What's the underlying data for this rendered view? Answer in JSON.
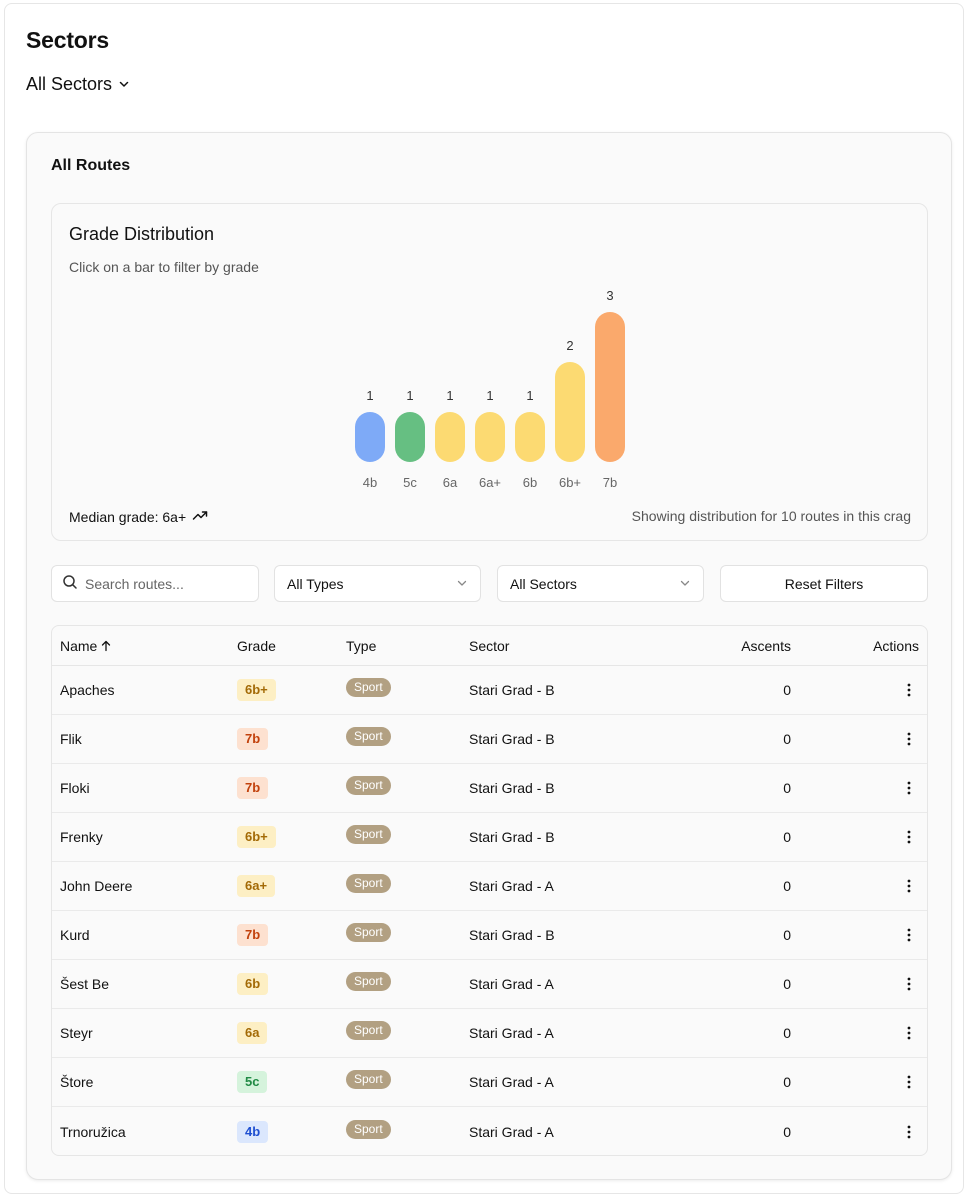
{
  "page": {
    "title": "Sectors",
    "sector_select": "All Sectors"
  },
  "card": {
    "title": "All Routes"
  },
  "distribution": {
    "title": "Grade Distribution",
    "subtitle": "Click on a bar to filter by grade",
    "median_label": "Median grade: 6a+",
    "showing_text": "Showing distribution for 10 routes in this crag"
  },
  "chart_data": {
    "type": "bar",
    "categories": [
      "4b",
      "5c",
      "6a",
      "6a+",
      "6b",
      "6b+",
      "7b"
    ],
    "values": [
      1,
      1,
      1,
      1,
      1,
      2,
      3
    ],
    "colors": [
      "#7eaaf7",
      "#66bf82",
      "#fcda72",
      "#fcda72",
      "#fcda72",
      "#fcda72",
      "#faa96c"
    ],
    "title": "Grade Distribution",
    "xlabel": "",
    "ylabel": "",
    "ylim": [
      0,
      3
    ]
  },
  "filters": {
    "search_placeholder": "Search routes...",
    "type_select": "All Types",
    "sector_select": "All Sectors",
    "reset_label": "Reset Filters"
  },
  "table": {
    "headers": {
      "name": "Name",
      "grade": "Grade",
      "type": "Type",
      "sector": "Sector",
      "ascents": "Ascents",
      "actions": "Actions"
    },
    "rows": [
      {
        "name": "Apaches",
        "grade": "6b+",
        "type": "Sport",
        "sector": "Stari Grad - B",
        "ascents": "0"
      },
      {
        "name": "Flik",
        "grade": "7b",
        "type": "Sport",
        "sector": "Stari Grad - B",
        "ascents": "0"
      },
      {
        "name": "Floki",
        "grade": "7b",
        "type": "Sport",
        "sector": "Stari Grad - B",
        "ascents": "0"
      },
      {
        "name": "Frenky",
        "grade": "6b+",
        "type": "Sport",
        "sector": "Stari Grad - B",
        "ascents": "0"
      },
      {
        "name": "John Deere",
        "grade": "6a+",
        "type": "Sport",
        "sector": "Stari Grad - A",
        "ascents": "0"
      },
      {
        "name": "Kurd",
        "grade": "7b",
        "type": "Sport",
        "sector": "Stari Grad - B",
        "ascents": "0"
      },
      {
        "name": "Šest Be",
        "grade": "6b",
        "type": "Sport",
        "sector": "Stari Grad - A",
        "ascents": "0"
      },
      {
        "name": "Steyr",
        "grade": "6a",
        "type": "Sport",
        "sector": "Stari Grad - A",
        "ascents": "0"
      },
      {
        "name": "Štore",
        "grade": "5c",
        "type": "Sport",
        "sector": "Stari Grad - A",
        "ascents": "0"
      },
      {
        "name": "Trnoružica",
        "grade": "4b",
        "type": "Sport",
        "sector": "Stari Grad - A",
        "ascents": "0"
      }
    ]
  },
  "badge_colors": {
    "yellow": {
      "bg": "#fdefc4",
      "fg": "#a36a06"
    },
    "orange": {
      "bg": "#fde1d0",
      "fg": "#c2410c"
    },
    "green": {
      "bg": "#d5f3dc",
      "fg": "#218a45"
    },
    "blue": {
      "bg": "#dbe7fd",
      "fg": "#1e4fd1"
    },
    "sport": "#b2a082"
  },
  "icons": {
    "sector_chevron": "chevron-down-icon",
    "median_trend": "trending-up-icon",
    "search": "search-icon",
    "select_chevron": "chevron-down-icon",
    "sort": "arrow-up-icon",
    "actions": "more-vertical-icon"
  }
}
